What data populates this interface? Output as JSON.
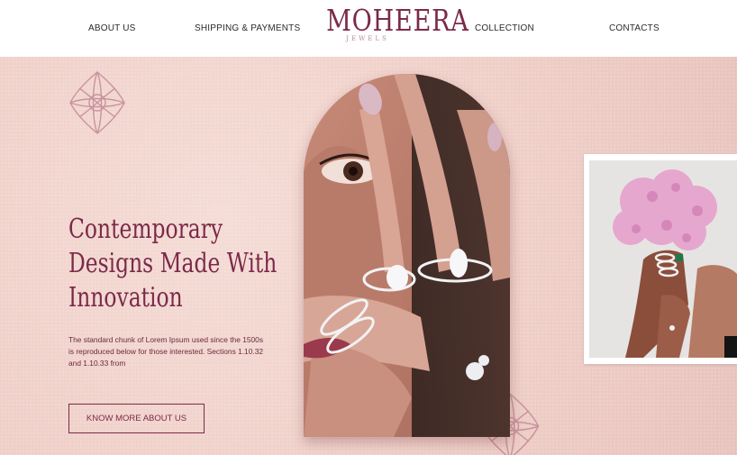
{
  "header": {
    "nav_left": [
      "ABOUT US",
      "SHIPPING & PAYMENTS"
    ],
    "nav_right": [
      "COLLECTION",
      "CONTACTS"
    ],
    "logo_title": "MOHEERA",
    "logo_subtitle": "JEWELS"
  },
  "hero": {
    "headline_lines": [
      "Contemporary",
      "Designs Made With",
      "Innovation"
    ],
    "description": "The standard chunk of Lorem Ipsum used since the 1500s is reproduced below for those interested. Sections 1.10.32 and 1.10.33 from",
    "cta_label": "KNOW MORE ABOUT US"
  },
  "images": {
    "main": "woman-face-with-diamond-rings-photo",
    "side": "hands-holding-pink-hydrangea-photo"
  },
  "colors": {
    "brand": "#7b2a4a",
    "hero_bg": "#efcfc8",
    "ornament": "#c9939f"
  }
}
